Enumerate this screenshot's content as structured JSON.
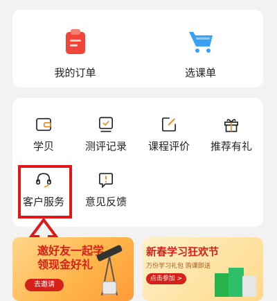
{
  "top_card": {
    "items": [
      {
        "label": "我的订单",
        "icon": "clipboard-icon",
        "color": "#f0463a"
      },
      {
        "label": "选课单",
        "icon": "cart-icon",
        "color": "#3aa2f5"
      }
    ]
  },
  "mid_card": {
    "items": [
      {
        "label": "学贝",
        "icon": "wallet-icon"
      },
      {
        "label": "测评记录",
        "icon": "assessment-icon"
      },
      {
        "label": "课程评价",
        "icon": "edit-square-icon"
      },
      {
        "label": "推荐有礼",
        "icon": "gift-icon"
      },
      {
        "label": "客户服务",
        "icon": "headset-icon"
      },
      {
        "label": "意见反馈",
        "icon": "feedback-icon"
      }
    ]
  },
  "banners": {
    "left": {
      "title_line1": "邀好友一起学",
      "title_line2": "领现金好礼",
      "button": "去邀请"
    },
    "right": {
      "title": "新春学习狂欢节",
      "subtitle": "万份学习礼包 购课即送",
      "button": "点击参加 >"
    }
  },
  "colors": {
    "accent": "#f28b1e",
    "highlight": "#e11616",
    "icon_stroke": "#222222"
  }
}
